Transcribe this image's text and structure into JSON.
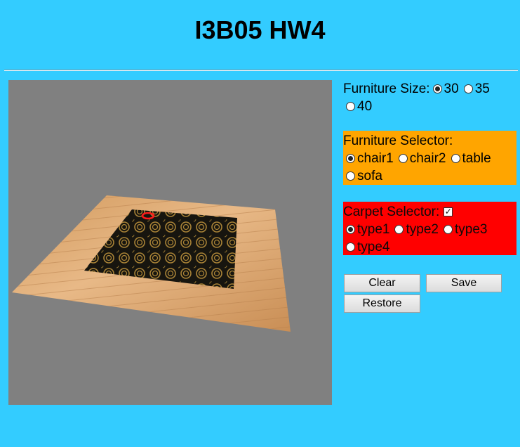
{
  "header": {
    "title": "I3B05 HW4"
  },
  "furniture_size": {
    "label": "Furniture Size:",
    "options": [
      "30",
      "35",
      "40"
    ],
    "selected": "30"
  },
  "furniture_selector": {
    "label": "Furniture Selector:",
    "options": [
      "chair1",
      "chair2",
      "table",
      "sofa"
    ],
    "selected": "chair1"
  },
  "carpet_selector": {
    "label": "Carpet Selector:",
    "enabled": true,
    "options": [
      "type1",
      "type2",
      "type3",
      "type4"
    ],
    "selected": "type1"
  },
  "buttons": {
    "clear": "Clear",
    "save": "Save",
    "restore": "Restore"
  },
  "colors": {
    "background": "#33ccff",
    "viewport": "#808080",
    "furniture_panel": "#ffa500",
    "carpet_panel": "#ff0000",
    "floor_wood": "#d9a066",
    "carpet_base": "#1a1a14",
    "carpet_swirl": "#b08a3c",
    "marker": "#ff1a1a"
  }
}
